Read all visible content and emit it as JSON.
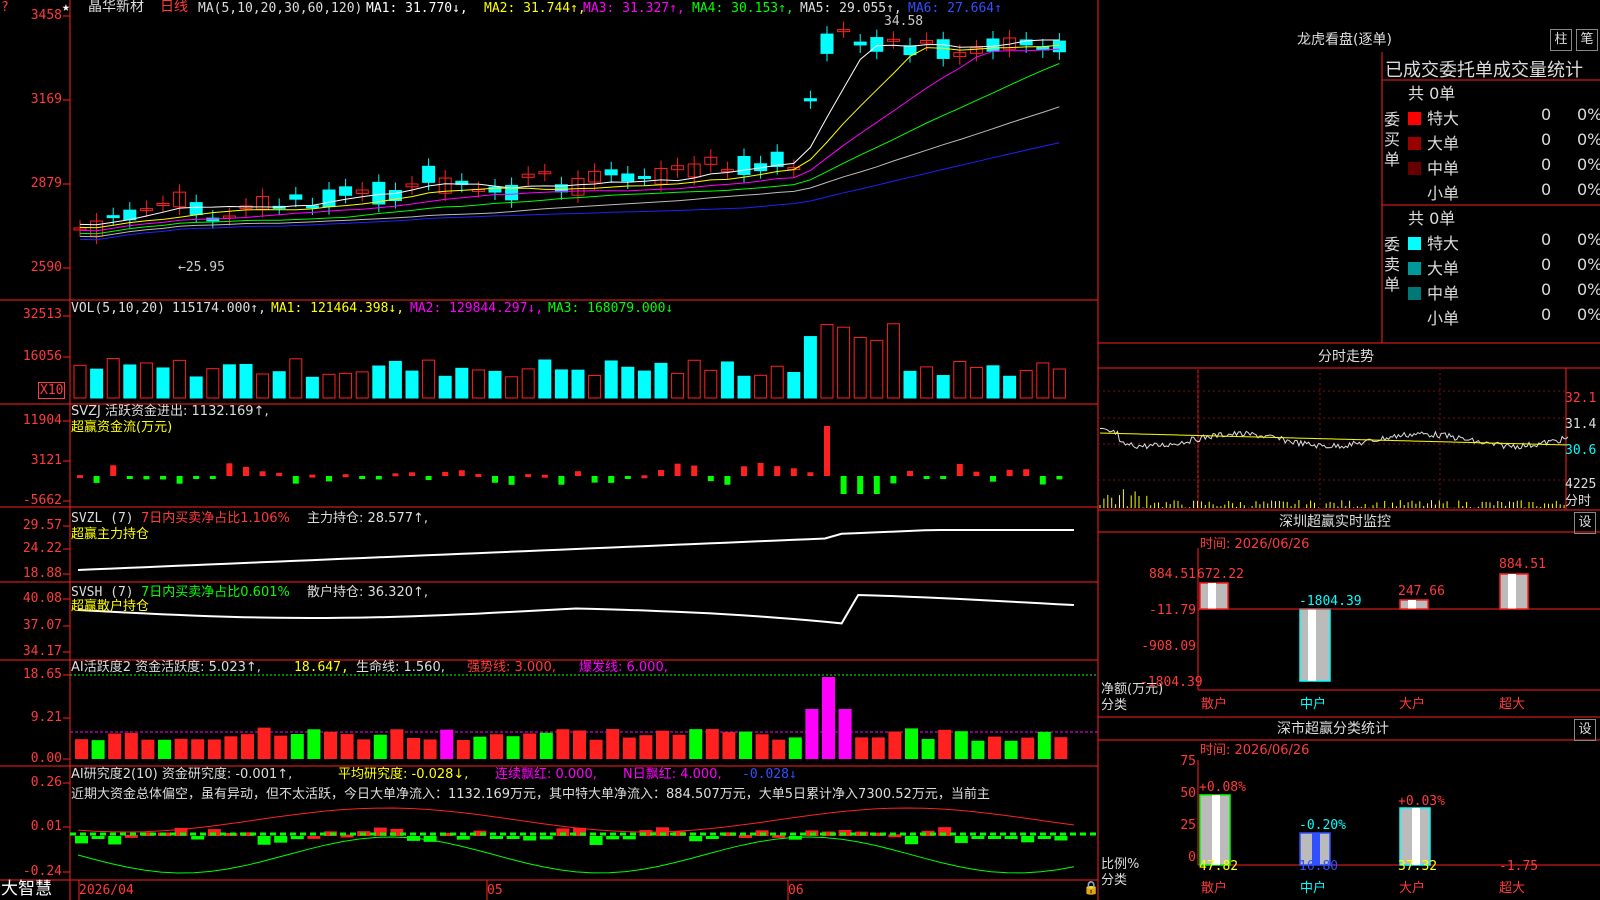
{
  "colors": {
    "up": "#ff2020",
    "down": "#00ffff",
    "grid": "#ff2020",
    "ma1": "#ffffff",
    "ma2": "#ffff00",
    "ma3": "#ff00ff",
    "ma4": "#00ff00",
    "ma5": "#bbbbbb",
    "ma6": "#2020ff"
  },
  "main": {
    "star": "★",
    "stock_name": "晶华新材",
    "period": "日线",
    "ma_params": "MA(5,10,20,30,60,120)",
    "ma1": "MA1: 31.770↓,",
    "ma2": "MA2: 31.744↑,",
    "ma3": "MA3: 31.327↑,",
    "ma4": "MA4: 30.153↑,",
    "ma5": "MA5: 29.055↑,",
    "ma6": "MA6: 27.664↑",
    "y_ticks": [
      "3458",
      "3169",
      "2879",
      "2590"
    ],
    "high_label": "34.58",
    "low_label": "←25.95",
    "question": "?"
  },
  "vol": {
    "title": "VOL(5,10,20)",
    "value": "115174.000↑,",
    "ma1": "MA1: 121464.398↓,",
    "ma2": "MA2: 129844.297↓,",
    "ma3": "MA3: 168079.000↓",
    "y_ticks": [
      "32513",
      "16056"
    ],
    "unit": "X10"
  },
  "svzj": {
    "line1": "SVZJ  活跃资金进出: 1132.169↑,",
    "line2": "超赢资金流(万元)",
    "y_ticks": [
      "11904",
      "3121",
      "-5662"
    ]
  },
  "svzl": {
    "name": "SVZL (7)",
    "pct": "7日内买卖净占比1.106%",
    "hold": "主力持仓: 28.577↑,",
    "line2": "超赢主力持仓",
    "y_ticks": [
      "29.57",
      "24.22",
      "18.88"
    ]
  },
  "svsh": {
    "name": "SVSH (7)",
    "pct": "7日内买卖净占比0.601%",
    "hold": "散户持仓: 36.320↑,",
    "line2": "超赢散户持仓",
    "y_ticks": [
      "40.08",
      "37.07",
      "34.17"
    ]
  },
  "ai1": {
    "name": "AI活跃度2 资金活跃度: 5.023↑,",
    "v2": "18.647,",
    "life": "生命线: 1.560,",
    "strong": "强势线: 3.000,",
    "burst": "爆发线: 6.000,",
    "y_ticks": [
      "18.65",
      "9.21",
      "0.00"
    ]
  },
  "ai2": {
    "name": "AI研究度2(10) 资金研究度: -0.001↑,",
    "avg": "平均研究度: -0.028↓,",
    "red": "连续飘红: 0.000,",
    "nday": "N日飘红: 4.000,",
    "last": "-0.028↓",
    "comment": "近期大资金总体偏空，虽有异动，但不太活跃，今日大单净流入：1132.169万元，其中特大单净流入：884.507万元，大单5日累计净入7300.52万元，当前主",
    "y_ticks": [
      "0.26",
      "0.01",
      "-0.24"
    ]
  },
  "bottom": {
    "brand": "大智慧",
    "dates": [
      "2026/04",
      "05",
      "06"
    ]
  },
  "right": {
    "lhkp_title": "龙虎看盘(逐单)",
    "btn1": "柱",
    "btn2": "笔",
    "header": "已成交委托单成交量统计",
    "buy_label": "委买单",
    "sell_label": "委卖单",
    "buy_total": "共 0单",
    "sell_total": "共 0单",
    "buy_rows": [
      {
        "name": "特大",
        "val": "0",
        "pct": "0%",
        "color": "#ff0000"
      },
      {
        "name": "大单",
        "val": "0",
        "pct": "0%",
        "color": "#990000"
      },
      {
        "name": "中单",
        "val": "0",
        "pct": "0%",
        "color": "#660000"
      },
      {
        "name": "小单",
        "val": "0",
        "pct": "0%",
        "color": ""
      }
    ],
    "sell_rows": [
      {
        "name": "特大",
        "val": "0",
        "pct": "0%",
        "color": "#00ffff"
      },
      {
        "name": "大单",
        "val": "0",
        "pct": "0%",
        "color": "#009999"
      },
      {
        "name": "中单",
        "val": "0",
        "pct": "0%",
        "color": "#007777"
      },
      {
        "name": "小单",
        "val": "0",
        "pct": "0%",
        "color": ""
      }
    ],
    "fs_title": "分时走势",
    "fs_ticks": [
      "32.1",
      "31.4",
      "30.6"
    ],
    "fs_vol": "4225",
    "fs_unit": "分时",
    "sz_title": "深圳超赢实时监控",
    "sz_btn": "设",
    "sz_time": "时间: 2026/06/26",
    "sz_ticks": [
      "884.51",
      "-11.79",
      "-908.09",
      "-1804.39"
    ],
    "sz_unit1": "净额(万元)",
    "sz_unit2": "分类",
    "sz_vals": [
      "672.22",
      "-1804.39",
      "247.66",
      "884.51"
    ],
    "cats": [
      "散户",
      "中户",
      "大户",
      "超大"
    ],
    "cl_title": "深市超赢分类统计",
    "cl_btn": "设",
    "cl_time": "时间: 2026/06/26",
    "cl_ticks": [
      "75",
      "50",
      "25",
      "0"
    ],
    "cl_unit1": "比例%",
    "cl_unit2": "分类",
    "cl_pcts": [
      "+0.08%",
      "-0.20%",
      "+0.03%"
    ],
    "cl_vals": [
      "47.82",
      "16.80",
      "37.32",
      "-1.75"
    ]
  }
}
